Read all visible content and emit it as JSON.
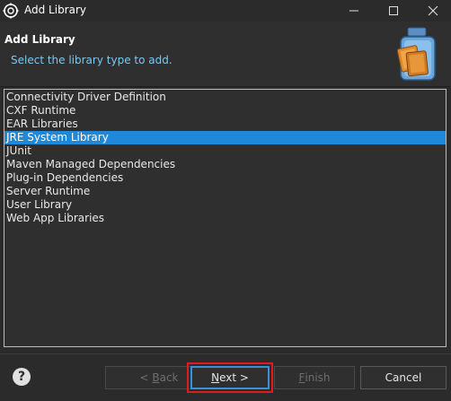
{
  "window": {
    "title": "Add Library",
    "minimize_glyph": "—",
    "maximize_glyph": "☐",
    "close_glyph": "✕"
  },
  "header": {
    "title": "Add Library",
    "subtitle": "Select the library type to add.",
    "icon": "library-jar-icon"
  },
  "library_types": [
    {
      "label": "Connectivity Driver Definition",
      "selected": false
    },
    {
      "label": "CXF Runtime",
      "selected": false
    },
    {
      "label": "EAR Libraries",
      "selected": false
    },
    {
      "label": "JRE System Library",
      "selected": true
    },
    {
      "label": "JUnit",
      "selected": false
    },
    {
      "label": "Maven Managed Dependencies",
      "selected": false
    },
    {
      "label": "Plug-in Dependencies",
      "selected": false
    },
    {
      "label": "Server Runtime",
      "selected": false
    },
    {
      "label": "User Library",
      "selected": false
    },
    {
      "label": "Web App Libraries",
      "selected": false
    }
  ],
  "buttons": {
    "help": "?",
    "back_prefix": "< ",
    "back_mnemonic": "B",
    "back_rest": "ack",
    "next_mnemonic": "N",
    "next_rest": "ext >",
    "finish_mnemonic": "F",
    "finish_rest": "inish",
    "cancel": "Cancel"
  },
  "colors": {
    "selection": "#1f88d8",
    "subtitle": "#7dc7f0",
    "highlight_box": "#e01b1b"
  }
}
